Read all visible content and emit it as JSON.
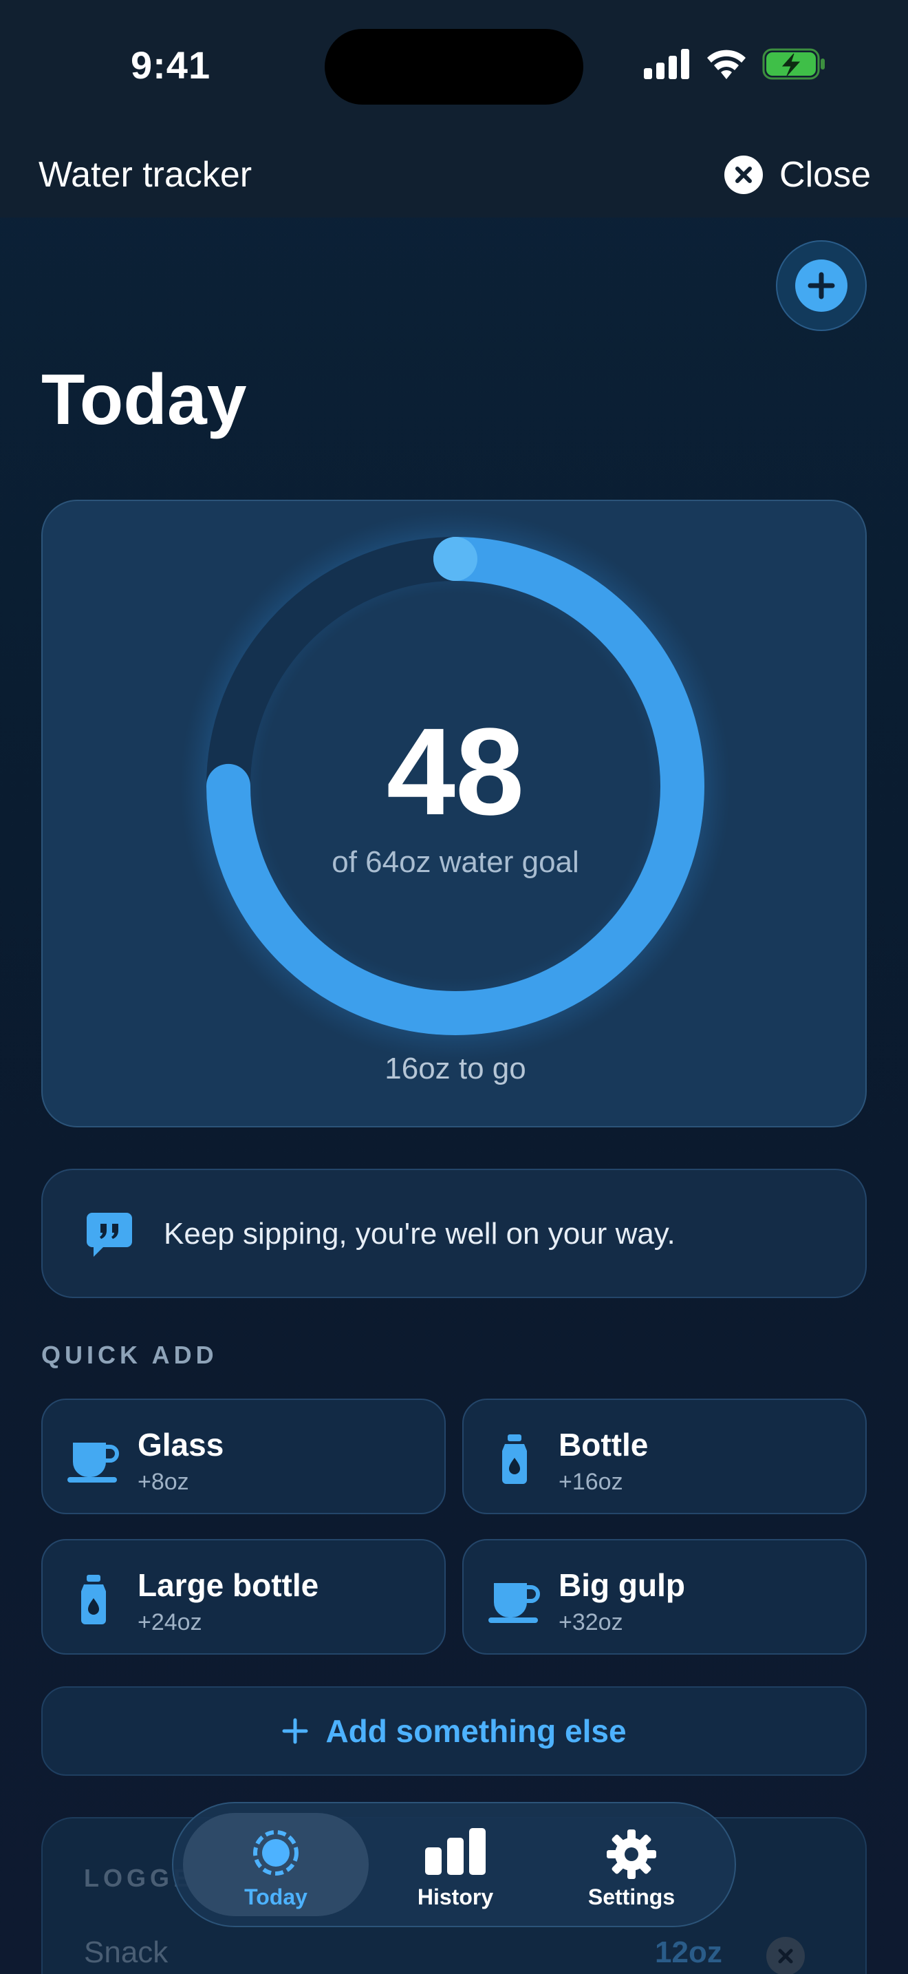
{
  "status_bar": {
    "time": "9:41"
  },
  "header": {
    "title": "Water tracker",
    "close_label": "Close"
  },
  "page": {
    "title": "Today"
  },
  "progress": {
    "value": "48",
    "caption": "of 64oz water goal",
    "remaining": "16oz to go",
    "fraction": 0.75
  },
  "tip": {
    "text": "Keep sipping, you're well on your way."
  },
  "quick_add": {
    "label": "QUICK ADD",
    "items": [
      {
        "label": "Glass",
        "amount": "+8oz",
        "icon": "cup-icon"
      },
      {
        "label": "Bottle",
        "amount": "+16oz",
        "icon": "bottle-icon"
      },
      {
        "label": "Large bottle",
        "amount": "+24oz",
        "icon": "bottle-icon"
      },
      {
        "label": "Big gulp",
        "amount": "+32oz",
        "icon": "cup-icon"
      }
    ],
    "add_else_label": "Add something else"
  },
  "logged": {
    "label": "LOGGED",
    "entries": [
      {
        "name": "Snack",
        "amount": "12oz"
      }
    ]
  },
  "tabs": [
    {
      "label": "Today",
      "icon": "today-ring-icon",
      "active": true
    },
    {
      "label": "History",
      "icon": "bar-chart-icon",
      "active": false
    },
    {
      "label": "Settings",
      "icon": "gear-icon",
      "active": false
    }
  ],
  "colors": {
    "accent": "#44a9f2",
    "card": "#18395a",
    "background": "#0b1a2e"
  }
}
